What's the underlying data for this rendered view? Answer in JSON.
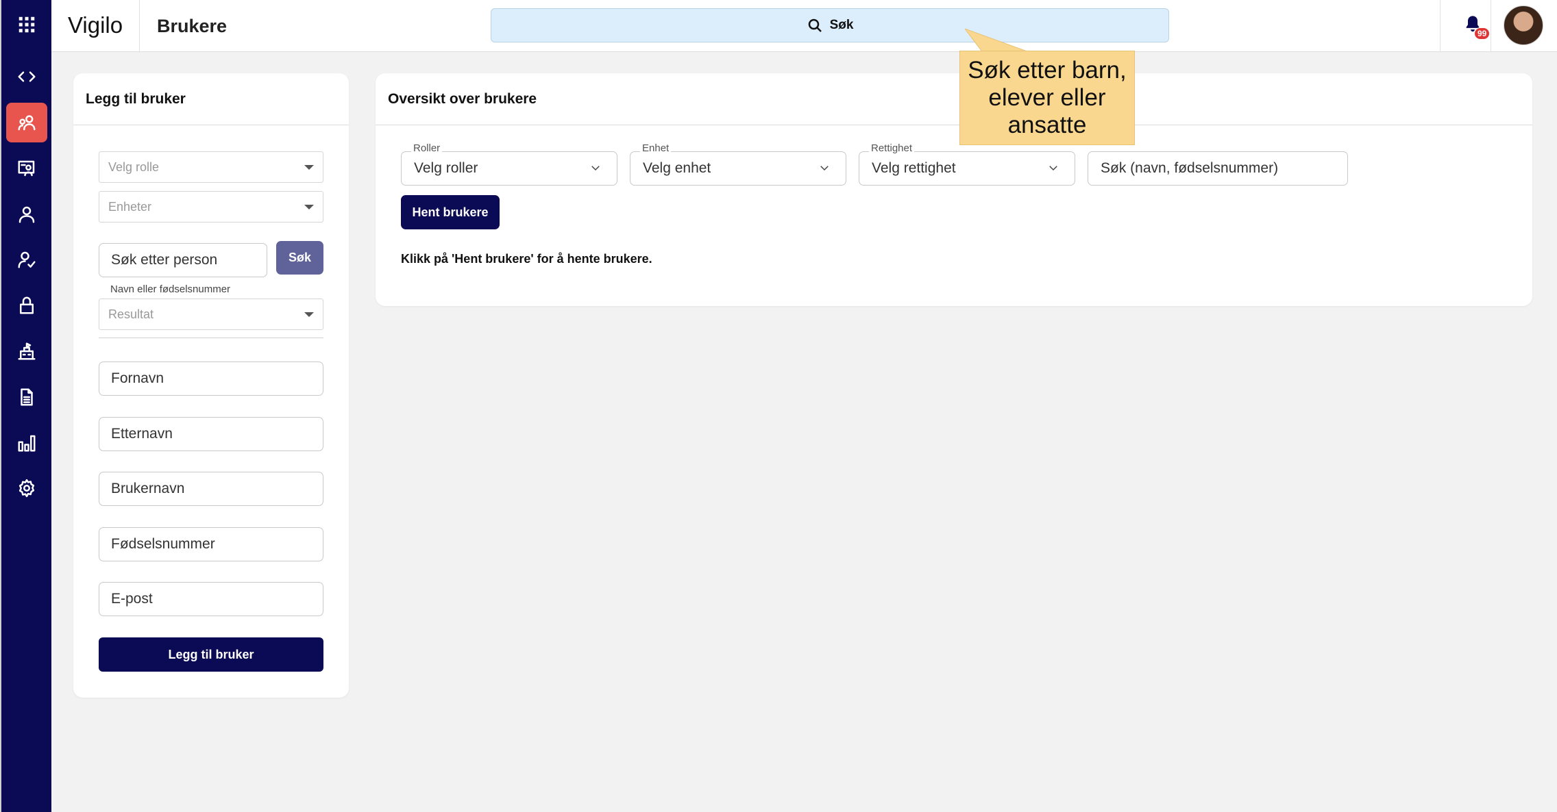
{
  "app": {
    "brand": "Vigilo",
    "page_title": "Brukere"
  },
  "header": {
    "search_label": "Søk",
    "notification_count": "99"
  },
  "tooltip": {
    "text": "Søk etter barn, elever eller ansatte"
  },
  "sidebar": {
    "items": [
      {
        "icon": "apps-grid-icon"
      },
      {
        "icon": "code-icon"
      },
      {
        "icon": "users-icon",
        "active": true
      },
      {
        "icon": "presentation-icon"
      },
      {
        "icon": "user-icon"
      },
      {
        "icon": "user-check-icon"
      },
      {
        "icon": "lock-icon"
      },
      {
        "icon": "school-icon"
      },
      {
        "icon": "document-icon"
      },
      {
        "icon": "bar-chart-icon"
      },
      {
        "icon": "gear-icon"
      }
    ]
  },
  "add_user": {
    "title": "Legg til bruker",
    "role_placeholder": "Velg rolle",
    "units_placeholder": "Enheter",
    "person_search_placeholder": "Søk etter person",
    "search_button": "Søk",
    "search_hint": "Navn eller fødselsnummer",
    "result_placeholder": "Resultat",
    "firstname_placeholder": "Fornavn",
    "lastname_placeholder": "Etternavn",
    "username_placeholder": "Brukernavn",
    "ssn_placeholder": "Fødselsnummer",
    "email_placeholder": "E-post",
    "submit_button": "Legg til bruker"
  },
  "overview": {
    "title": "Oversikt over brukere",
    "filters": {
      "roles_label": "Roller",
      "roles_value": "Velg roller",
      "unit_label": "Enhet",
      "unit_value": "Velg enhet",
      "permission_label": "Rettighet",
      "permission_value": "Velg rettighet",
      "search_placeholder": "Søk (navn, fødselsnummer)"
    },
    "fetch_button": "Hent brukere",
    "info_text": "Klikk på 'Hent brukere' for å hente brukere."
  },
  "colors": {
    "sidebar": "#0a0a55",
    "active": "#e8554e",
    "primary": "#0a0a55",
    "tooltip": "#fad78f",
    "search_bg": "#dceefb"
  }
}
